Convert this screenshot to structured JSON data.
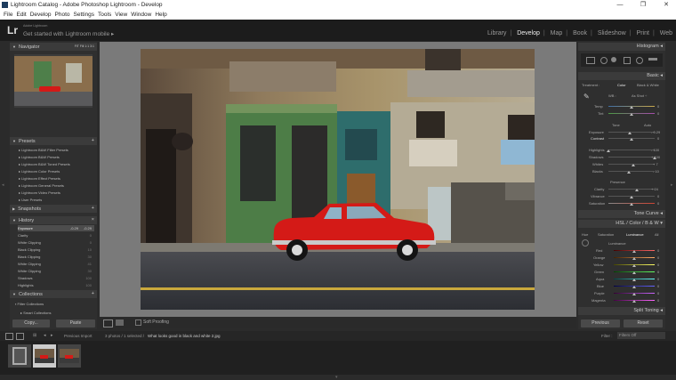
{
  "window": {
    "title": "Lightroom Catalog - Adobe Photoshop Lightroom - Develop",
    "minimize": "—",
    "maximize": "❐",
    "close": "✕"
  },
  "menu": [
    "File",
    "Edit",
    "Develop",
    "Photo",
    "Settings",
    "Tools",
    "View",
    "Window",
    "Help"
  ],
  "identity": {
    "logo": "Lr",
    "small": "Adobe Lightroom",
    "big": "Get started with Lightroom mobile"
  },
  "modules": [
    "Library",
    "Develop",
    "Map",
    "Book",
    "Slideshow",
    "Print",
    "Web"
  ],
  "active_module": "Develop",
  "left": {
    "navigator": {
      "title": "Navigator",
      "fit": "FIT  Fill  1:1  3:1"
    },
    "presets": {
      "title": "Presets",
      "items": [
        "Lightroom B&W Filter Presets",
        "Lightroom B&W Presets",
        "Lightroom B&W Toned Presets",
        "Lightroom Color Presets",
        "Lightroom Effect Presets",
        "Lightroom General Presets",
        "Lightroom Video Presets",
        "User Presets"
      ]
    },
    "snapshots": {
      "title": "Snapshots"
    },
    "history": {
      "title": "History",
      "rows": [
        {
          "name": "Exposure",
          "v1": "-0.29",
          "v2": "-0.29"
        },
        {
          "name": "Clarity",
          "v1": "",
          "v2": "0"
        },
        {
          "name": "White Clipping",
          "v1": "",
          "v2": "0"
        },
        {
          "name": "Black Clipping",
          "v1": "",
          "v2": "10"
        },
        {
          "name": "Black Clipping",
          "v1": "",
          "v2": "30"
        },
        {
          "name": "White Clipping",
          "v1": "",
          "v2": "41"
        },
        {
          "name": "White Clipping",
          "v1": "",
          "v2": "30"
        },
        {
          "name": "Shadows",
          "v1": "",
          "v2": "100"
        },
        {
          "name": "Highlights",
          "v1": "",
          "v2": "100"
        },
        {
          "name": "Import (10/08/2018 15:24:25)",
          "v1": "",
          "v2": ""
        }
      ]
    },
    "collections": {
      "title": "Collections",
      "items": [
        "Filter Collections",
        "Smart Collections"
      ]
    },
    "buttons": {
      "copy": "Copy...",
      "paste": "Paste"
    }
  },
  "toolbar": {
    "soft_proofing": "Soft Proofing"
  },
  "right": {
    "histogram": "Histogram",
    "basic": "Basic",
    "treatment": {
      "label": "Treatment :",
      "color": "Color",
      "bw": "Black & White"
    },
    "wb": {
      "label": "WB :",
      "value": "As Shot ÷"
    },
    "temp": {
      "label": "Temp",
      "value": "0"
    },
    "tint": {
      "label": "Tint",
      "value": "0"
    },
    "tone": {
      "label": "Tone",
      "auto": "Auto"
    },
    "exposure": {
      "label": "Exposure",
      "value": "- 0.29",
      "level": 0.47
    },
    "contrast": {
      "label": "Contrast",
      "value": "0",
      "level": 0.5
    },
    "highlights": {
      "label": "Highlights",
      "value": "- 100",
      "level": 0.0
    },
    "shadows": {
      "label": "Shadows",
      "value": "+ 100",
      "level": 1.0
    },
    "whites": {
      "label": "Whites",
      "value": "+ 7",
      "level": 0.53
    },
    "blacks": {
      "label": "Blacks",
      "value": "- 10",
      "level": 0.45
    },
    "presence": "Presence",
    "clarity": {
      "label": "Clarity",
      "value": "+ 24",
      "level": 0.62
    },
    "vibrance": {
      "label": "Vibrance",
      "value": "0",
      "level": 0.5
    },
    "saturation": {
      "label": "Saturation",
      "value": "0",
      "level": 0.5
    },
    "tone_curve": "Tone Curve",
    "hsl_tabs": [
      "HSL",
      "Color",
      "B & W"
    ],
    "hsl_sub": [
      "Hue",
      "Saturation",
      "Luminance",
      "All"
    ],
    "luminance": "Luminance",
    "colors": [
      {
        "name": "Red",
        "value": "0"
      },
      {
        "name": "Orange",
        "value": "0"
      },
      {
        "name": "Yellow",
        "value": "0"
      },
      {
        "name": "Green",
        "value": "0"
      },
      {
        "name": "Aqua",
        "value": "0"
      },
      {
        "name": "Blue",
        "value": "0"
      },
      {
        "name": "Purple",
        "value": "0"
      },
      {
        "name": "Magenta",
        "value": "0"
      }
    ],
    "split_toning": "Split Toning",
    "buttons": {
      "previous": "Previous",
      "reset": "Reset"
    }
  },
  "filmbar": {
    "source": "Previous Import",
    "count": "3 photos / 1 selected /",
    "filename": "What looks good in black and white 2.jpg",
    "filter_label": "Filter :",
    "filter_value": "Filters Off"
  },
  "colors": {
    "accent": "#e0e0e0",
    "car": "#d41a17",
    "panel": "#2f2f2f"
  }
}
